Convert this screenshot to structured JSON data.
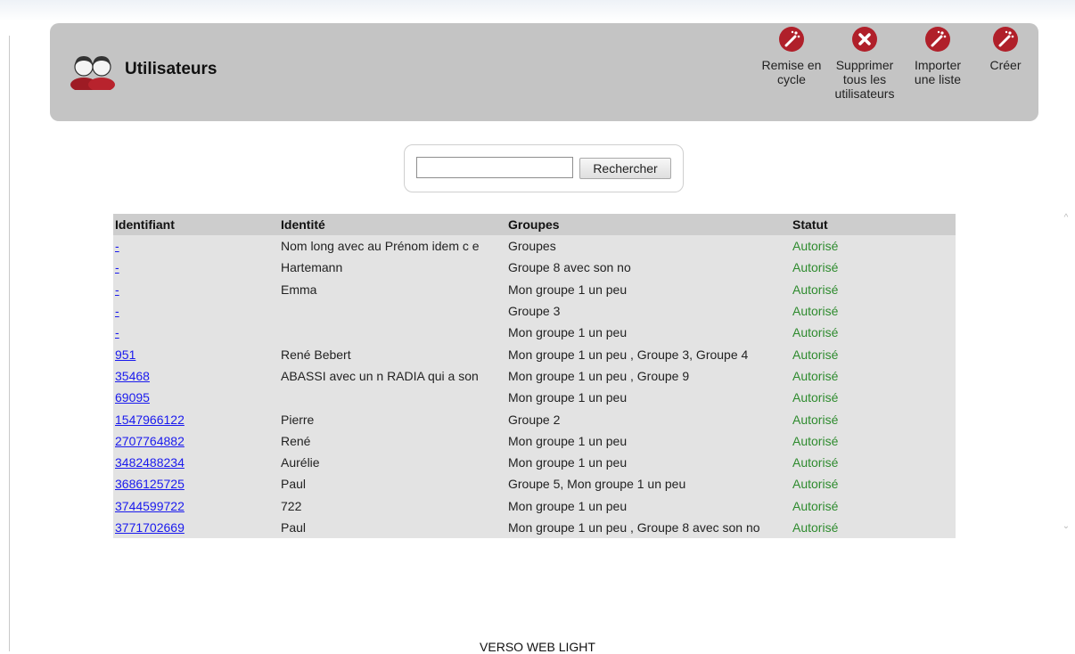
{
  "header": {
    "title": "Utilisateurs",
    "actions": [
      {
        "label": "Remise en cycle",
        "icon": "recycle-wand-icon"
      },
      {
        "label": "Supprimer tous les utilisateurs",
        "icon": "delete-x-icon"
      },
      {
        "label": "Importer une liste",
        "icon": "import-wand-icon"
      },
      {
        "label": "Créer",
        "icon": "create-wand-icon"
      }
    ]
  },
  "search": {
    "value": "",
    "button_label": "Rechercher"
  },
  "table": {
    "columns": [
      "Identifiant",
      "Identité",
      "Groupes",
      "Statut"
    ],
    "rows": [
      {
        "id": "-",
        "identity": "Nom long avec au Prénom idem c e",
        "groups": "Groupes",
        "status": "Autorisé"
      },
      {
        "id": "-",
        "identity": "Hartemann",
        "groups": "Groupe 8 avec son no",
        "status": "Autorisé"
      },
      {
        "id": "-",
        "identity": "Emma",
        "groups": "Mon groupe 1 un peu",
        "status": "Autorisé"
      },
      {
        "id": "-",
        "identity": "",
        "groups": "Groupe 3",
        "status": "Autorisé"
      },
      {
        "id": "-",
        "identity": "",
        "groups": "Mon groupe 1 un peu",
        "status": "Autorisé"
      },
      {
        "id": "951",
        "identity": "René Bebert",
        "groups": "Mon groupe 1 un peu , Groupe 3, Groupe 4",
        "status": "Autorisé"
      },
      {
        "id": "35468",
        "identity": "ABASSI avec un n RADIA qui a son",
        "groups": "Mon groupe 1 un peu , Groupe 9",
        "status": "Autorisé"
      },
      {
        "id": "69095",
        "identity": "",
        "groups": "Mon groupe 1 un peu",
        "status": "Autorisé"
      },
      {
        "id": "1547966122",
        "identity": "Pierre",
        "groups": "Groupe 2",
        "status": "Autorisé"
      },
      {
        "id": "2707764882",
        "identity": "René",
        "groups": "Mon groupe 1 un peu",
        "status": "Autorisé"
      },
      {
        "id": "3482488234",
        "identity": "Aurélie",
        "groups": "Mon groupe 1 un peu",
        "status": "Autorisé"
      },
      {
        "id": "3686125725",
        "identity": "Paul",
        "groups": "Groupe 5, Mon groupe 1 un peu",
        "status": "Autorisé"
      },
      {
        "id": "3744599722",
        "identity": "722",
        "groups": "Mon groupe 1 un peu",
        "status": "Autorisé"
      },
      {
        "id": "3771702669",
        "identity": "Paul",
        "groups": "Mon groupe 1 un peu , Groupe 8 avec son no",
        "status": "Autorisé"
      }
    ]
  },
  "footer": {
    "text": "VERSO WEB LIGHT"
  },
  "colors": {
    "header_bg": "#c4c4c4",
    "icon_red": "#b0202a",
    "link": "#1a1aee",
    "status_green": "#2e8b2e",
    "table_bg": "#e3e3e3"
  }
}
